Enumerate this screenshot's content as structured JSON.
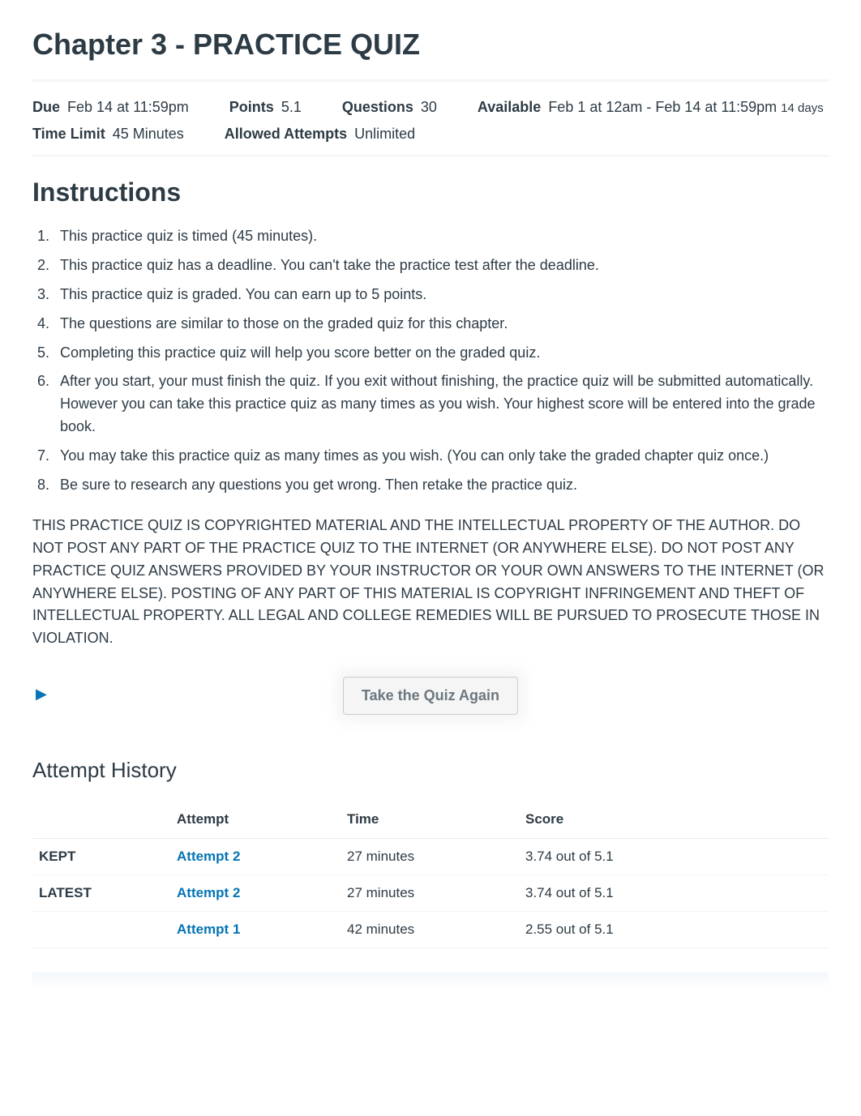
{
  "title": "Chapter 3 - PRACTICE QUIZ",
  "meta": {
    "due_label": "Due",
    "due_value": "Feb 14 at 11:59pm",
    "points_label": "Points",
    "points_value": "5.1",
    "questions_label": "Questions",
    "questions_value": "30",
    "available_label": "Available",
    "available_value": "Feb 1 at 12am - Feb 14 at 11:59pm",
    "available_days": "14 days",
    "timelimit_label": "Time Limit",
    "timelimit_value": "45 Minutes",
    "allowed_label": "Allowed Attempts",
    "allowed_value": "Unlimited"
  },
  "instructions_heading": "Instructions",
  "instructions": [
    "This practice quiz is timed (45 minutes).",
    "This practice quiz has a deadline. You can't take the practice test after the deadline.",
    "This practice quiz is graded. You can earn up to 5 points.",
    "The questions are similar to those on the graded quiz for this chapter.",
    "Completing this practice quiz will help you score better on the graded quiz.",
    "After you start, your must finish the quiz. If you exit without finishing, the practice quiz will be submitted automatically. However you can take this practice quiz as many times as you wish. Your highest score will be entered into the grade book.",
    "You may take this practice quiz as many times as you wish. (You can only take the graded chapter quiz once.)",
    "Be sure to research any questions you get wrong. Then retake the practice quiz."
  ],
  "copyright_notice": "THIS PRACTICE QUIZ IS COPYRIGHTED MATERIAL AND THE INTELLECTUAL PROPERTY OF THE AUTHOR. DO NOT POST ANY PART OF THE PRACTICE QUIZ TO THE INTERNET (OR ANYWHERE ELSE). DO NOT POST ANY PRACTICE QUIZ ANSWERS PROVIDED BY YOUR INSTRUCTOR OR YOUR OWN ANSWERS TO THE INTERNET (OR ANYWHERE ELSE). POSTING OF ANY PART OF THIS MATERIAL IS COPYRIGHT INFRINGEMENT AND THEFT OF INTELLECTUAL PROPERTY. ALL LEGAL AND COLLEGE REMEDIES WILL BE PURSUED TO PROSECUTE THOSE IN VIOLATION.",
  "take_quiz_label": "Take the Quiz Again",
  "disclosure_icon": "▶",
  "attempt_history": {
    "heading": "Attempt History",
    "headers": {
      "status": "",
      "attempt": "Attempt",
      "time": "Time",
      "score": "Score"
    },
    "rows": [
      {
        "status": "KEPT",
        "attempt": "Attempt 2",
        "time": "27 minutes",
        "score": "3.74 out of 5.1"
      },
      {
        "status": "LATEST",
        "attempt": "Attempt 2",
        "time": "27 minutes",
        "score": "3.74 out of 5.1"
      },
      {
        "status": "",
        "attempt": "Attempt 1",
        "time": "42 minutes",
        "score": "2.55 out of 5.1"
      }
    ]
  }
}
